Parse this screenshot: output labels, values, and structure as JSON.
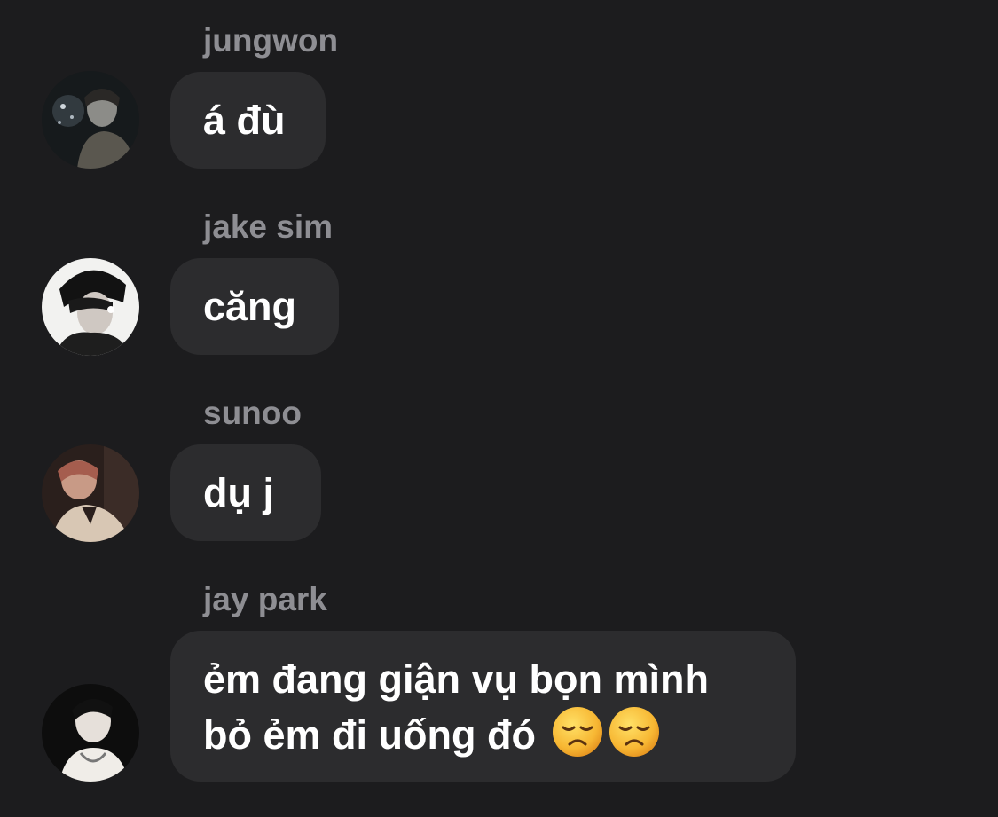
{
  "messages": [
    {
      "sender": "jungwon",
      "text": "á đù",
      "avatar": "avatar-photo"
    },
    {
      "sender": "jake sim",
      "text": "căng",
      "avatar": "avatar-photo"
    },
    {
      "sender": "sunoo",
      "text": "dụ j",
      "avatar": "avatar-photo"
    },
    {
      "sender": "jay park",
      "text_lines": [
        "ẻm đang giận vụ bọn mình",
        "bỏ ẻm đi uống đó"
      ],
      "emojis": [
        "disappointed-face-emoji",
        "disappointed-face-emoji"
      ],
      "avatar": "avatar-photo"
    }
  ],
  "colors": {
    "background": "#1c1c1e",
    "bubble": "#2c2c2e",
    "sender_name": "#8e8e93",
    "message_text": "#ffffff"
  }
}
